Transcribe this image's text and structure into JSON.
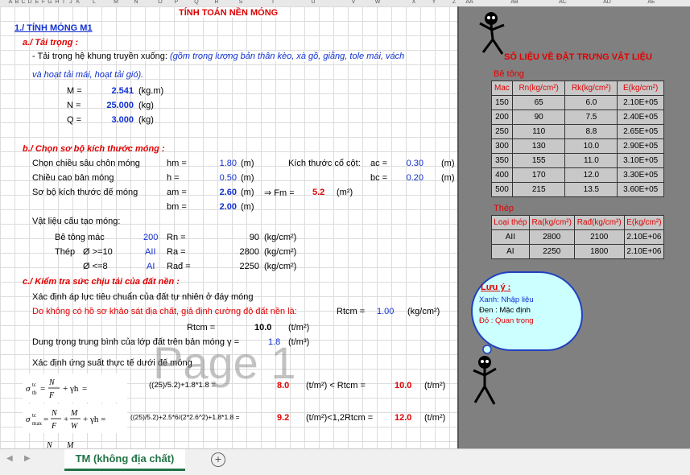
{
  "column_headers": [
    "A",
    "B",
    "C",
    "D",
    "E",
    "F",
    "G",
    "H",
    "I",
    "J",
    "K",
    "L",
    "M",
    "N",
    "O",
    "P",
    "Q",
    "R",
    "S",
    "T",
    "U",
    "V",
    "W",
    "X",
    "Y",
    "Z",
    "AA",
    "AB",
    "AC",
    "AD",
    "AE"
  ],
  "title": "TÍNH TOÁN NỀN MÓNG",
  "sec1": "1./ TÍNH MÓNG M1",
  "secA": {
    "heading": "a./ Tải trọng :",
    "line1": "- Tải trọng hệ khung truyền xuống:",
    "line1_note": "(gồm trọng lượng bản thân kèo, xà gồ, giằng, tole mái, vách",
    "line2_note": "và hoạt tải mái, hoạt tải gió).",
    "M_label": "M =",
    "M_value": "2.541",
    "M_unit": "(kg.m)",
    "N_label": "N =",
    "N_value": "25.000",
    "N_unit": "(kg)",
    "Q_label": "Q =",
    "Q_value": "3.000",
    "Q_unit": "(kg)"
  },
  "secB": {
    "heading": "b./ Chọn sơ bộ kích thước móng :",
    "depth_label": "Chọn chiều sâu chôn móng",
    "depth_sym": "hm =",
    "depth_val": "1.80",
    "depth_unit": "(m)",
    "col_label": "Kích thước cổ cột:",
    "ac_sym": "ac =",
    "ac_val": "0.30",
    "ac_unit": "(m)",
    "h_label": "Chiều cao bản móng",
    "h_sym": "h =",
    "h_val": "0.50",
    "h_unit": "(m)",
    "bc_sym": "bc =",
    "bc_val": "0.20",
    "bc_unit": "(m)",
    "size_label": "Sơ bộ kích thước đế móng",
    "am_sym": "am =",
    "am_val": "2.60",
    "am_unit": "(m)",
    "arrow": "⇒ Fm =",
    "Fm_val": "5.2",
    "Fm_unit": "(m²)",
    "bm_sym": "bm =",
    "bm_val": "2.00",
    "bm_unit": "(m)",
    "mat_label": "Vật liệu cấu tạo móng:",
    "concrete_label": "Bê tông mác",
    "concrete_val": "200",
    "Rn_sym": "Rn =",
    "Rn_val": "90",
    "Rn_unit": "(kg/cm²)",
    "steel_label": "Thép",
    "steel1": "Ø >=10",
    "steel1_type": "AII",
    "Ra_sym": "Ra =",
    "Ra_val": "2800",
    "Ra_unit": "(kg/cm²)",
    "steel2": "Ø <=8",
    "steel2_type": "AI",
    "Rad_sym": "Rađ =",
    "Rad_val": "2250",
    "Rad_unit": "(kg/cm²)"
  },
  "secC": {
    "heading": "c./ Kiểm tra sức chịu tải của đất nền :",
    "line1": "Xác định áp lực tiêu chuẩn của đất tự nhiên ở đáy móng",
    "line2": "Do không có hồ sơ khảo sát địa chất, giả định cường độ đất nền là:",
    "Rtc_sym": "Rtcm =",
    "Rtc_val": "1.00",
    "Rtc_unit": "(kg/cm²)",
    "Rtc2_sym": "Rtcm =",
    "Rtc2_val": "10.0",
    "Rtc2_unit": "(t/m²)",
    "gamma_label": "Dung trọng trung bình của lớp đất trên bản móng γ =",
    "gamma_val": "1.8",
    "gamma_unit": "(t/m³)",
    "stress_label": "Xác định ứng suất thực tế dưới đế móng",
    "f1_expr": "((25)/5.2)+1.8*1.8 =",
    "f1_val": "8.0",
    "f1_cmp": "(t/m²) < Rtcm =",
    "f1_R": "10.0",
    "f1_unit": "(t/m²)",
    "f2_expr": "((25)/5.2)+2.5*6/(2*2.6^2)+1.8*1.8 =",
    "f2_val": "9.2",
    "f2_cmp": "(t/m²)<1,2Rtcm =",
    "f2_R": "12.0",
    "f2_unit": "(t/m²)"
  },
  "watermark": "Page 1",
  "right_panel": {
    "title": "SỐ LIỆU VỀ ĐẶT TRƯNG VẬT LIỆU",
    "concrete_title": "Bê tông",
    "concrete_headers": [
      "Mac",
      "Rn(kg/cm²)",
      "Rk(kg/cm²)",
      "E(kg/cm²)"
    ],
    "concrete_rows": [
      [
        "150",
        "65",
        "6.0",
        "2.10E+05"
      ],
      [
        "200",
        "90",
        "7.5",
        "2.40E+05"
      ],
      [
        "250",
        "110",
        "8.8",
        "2.65E+05"
      ],
      [
        "300",
        "130",
        "10.0",
        "2.90E+05"
      ],
      [
        "350",
        "155",
        "11.0",
        "3.10E+05"
      ],
      [
        "400",
        "170",
        "12.0",
        "3.30E+05"
      ],
      [
        "500",
        "215",
        "13.5",
        "3.60E+05"
      ]
    ],
    "steel_title": "Thép",
    "steel_headers": [
      "Loại thép",
      "Ra(kg/cm²)",
      "Rađ(kg/cm²)",
      "E(kg/cm²)"
    ],
    "steel_rows": [
      [
        "AII",
        "2800",
        "2100",
        "2.10E+06"
      ],
      [
        "AI",
        "2250",
        "1800",
        "2.10E+06"
      ]
    ],
    "note_title": "Lưu ý :",
    "note_lines": [
      "Xanh: Nhập liệu",
      "Đen   : Mặc định",
      "Đỏ     : Quan trọng"
    ]
  },
  "tab_label": "TM (không địa chất)",
  "colors": {
    "red": "#e00000",
    "blue": "#1030d0",
    "panel": "#808080",
    "cloud": "#ccffff",
    "tab": "#217346"
  }
}
